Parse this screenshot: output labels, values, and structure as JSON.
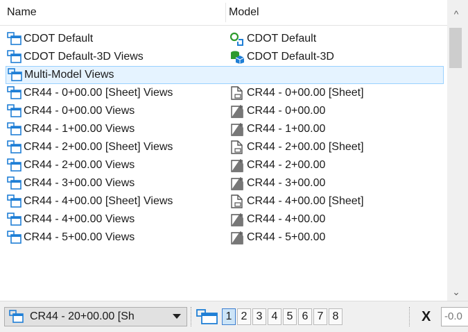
{
  "header": {
    "col_name": "Name",
    "col_model": "Model"
  },
  "rows": [
    {
      "name": "CDOT Default",
      "model": "CDOT Default",
      "model_icon": "model-2d-icon"
    },
    {
      "name": "CDOT Default-3D Views",
      "model": "CDOT Default-3D",
      "model_icon": "model-3d-icon"
    },
    {
      "name": "Multi-Model Views",
      "model": "",
      "model_icon": ""
    },
    {
      "name": "CR44 - 0+00.00 [Sheet] Views",
      "model": "CR44 - 0+00.00 [Sheet]",
      "model_icon": "sheet-model-icon"
    },
    {
      "name": "CR44 - 0+00.00 Views",
      "model": "CR44 - 0+00.00",
      "model_icon": "drawing-model-icon"
    },
    {
      "name": "CR44 - 1+00.00 Views",
      "model": "CR44 - 1+00.00",
      "model_icon": "drawing-model-icon"
    },
    {
      "name": "CR44 - 2+00.00 [Sheet] Views",
      "model": "CR44 - 2+00.00 [Sheet]",
      "model_icon": "sheet-model-icon"
    },
    {
      "name": "CR44 - 2+00.00 Views",
      "model": "CR44 - 2+00.00",
      "model_icon": "drawing-model-icon"
    },
    {
      "name": "CR44 - 3+00.00 Views",
      "model": "CR44 - 3+00.00",
      "model_icon": "drawing-model-icon"
    },
    {
      "name": "CR44 - 4+00.00 [Sheet] Views",
      "model": "CR44 - 4+00.00 [Sheet]",
      "model_icon": "sheet-model-icon"
    },
    {
      "name": "CR44 - 4+00.00 Views",
      "model": "CR44 - 4+00.00",
      "model_icon": "drawing-model-icon"
    },
    {
      "name": "CR44 - 5+00.00 Views",
      "model": "CR44 - 5+00.00",
      "model_icon": "drawing-model-icon"
    }
  ],
  "selected_row": 2,
  "toolbar": {
    "combo_value": "CR44 - 20+00.00 [Sh",
    "view_buttons": [
      "1",
      "2",
      "3",
      "4",
      "5",
      "6",
      "7",
      "8"
    ],
    "active_view": "1",
    "x_label": "X",
    "x_value": "-0.0"
  },
  "colors": {
    "icon_blue": "#1f7fd6",
    "model_green": "#2e9a2e",
    "selection": "#e5f3ff"
  }
}
